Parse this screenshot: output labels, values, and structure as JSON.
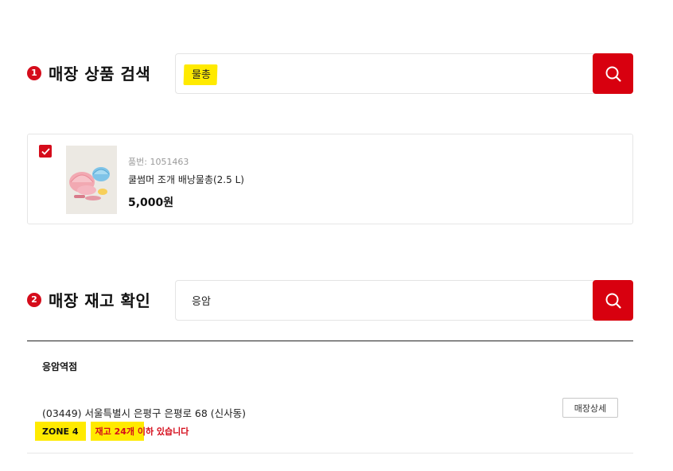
{
  "section1": {
    "step": "1",
    "title": "매장 상품 검색",
    "search_value": "물총"
  },
  "product": {
    "checked": true,
    "code": "품번: 1051463",
    "name": "쿨썸머 조개 배낭물총(2.5 L)",
    "price": "5,000원"
  },
  "section2": {
    "step": "2",
    "title": "매장 재고 확인",
    "search_value": "응암"
  },
  "store": {
    "name": "응암역점",
    "address": "(03449) 서울특별시 은평구 은평로 68 (신사동)",
    "detail_button": "매장상세",
    "zone": "ZONE 4",
    "stock_message": "재고 24개 이하 있습니다"
  },
  "icons": {
    "search": "search-icon",
    "check": "check-icon"
  },
  "colors": {
    "accent": "#d8000f",
    "highlight": "#ffea00"
  }
}
